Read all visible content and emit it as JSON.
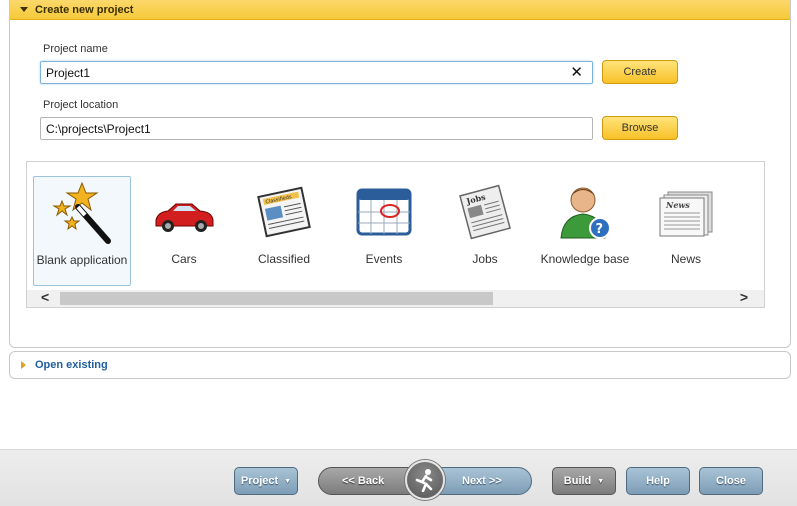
{
  "create_panel": {
    "title": "Create new project"
  },
  "form": {
    "project_name_label": "Project name",
    "project_name_value": "Project1",
    "clear_glyph": "✕",
    "create_label": "Create",
    "project_location_label": "Project location",
    "project_location_value": "C:\\projects\\Project1",
    "browse_label": "Browse"
  },
  "templates": [
    {
      "label": "Blank application",
      "icon": "magic-wand-icon",
      "selected": true
    },
    {
      "label": "Cars",
      "icon": "car-icon"
    },
    {
      "label": "Classified",
      "icon": "classified-newspaper-icon"
    },
    {
      "label": "Events",
      "icon": "calendar-icon"
    },
    {
      "label": "Jobs",
      "icon": "jobs-newspaper-icon"
    },
    {
      "label": "Knowledge base",
      "icon": "help-user-icon"
    },
    {
      "label": "News",
      "icon": "news-icon"
    }
  ],
  "scrollbar": {
    "left_arrow": "<",
    "right_arrow": ">"
  },
  "open_panel": {
    "title": "Open existing"
  },
  "toolbar": {
    "project_label": "Project",
    "back_label": "<< Back",
    "next_label": "Next >>",
    "build_label": "Build",
    "help_label": "Help",
    "close_label": "Close",
    "dropdown_caret": "▼"
  },
  "colors": {
    "accent_yellow": "#f6c93a",
    "button_blue": "#7d9db5",
    "link_blue": "#1f5fa0"
  }
}
